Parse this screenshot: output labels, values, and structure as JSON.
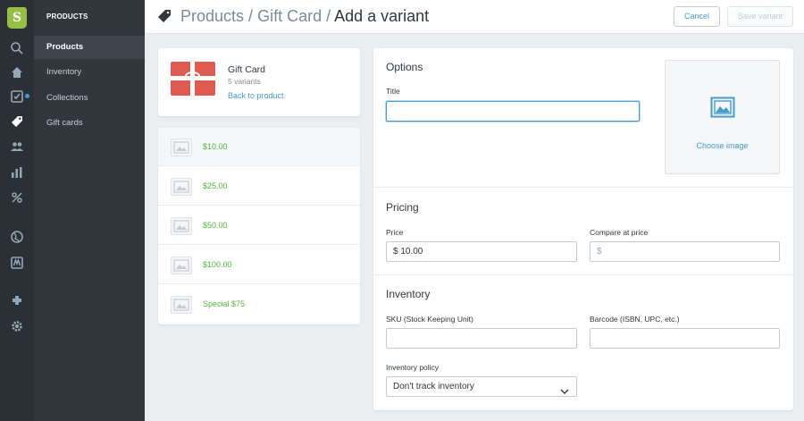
{
  "nav": {
    "header": "PRODUCTS",
    "items": [
      {
        "label": "Products",
        "active": true
      },
      {
        "label": "Inventory",
        "active": false
      },
      {
        "label": "Collections",
        "active": false
      },
      {
        "label": "Gift cards",
        "active": false
      }
    ]
  },
  "rail_icons": [
    "search-icon",
    "home-icon",
    "orders-icon",
    "tag-icon",
    "customers-icon",
    "reports-icon",
    "discounts-icon",
    "globe-icon",
    "apps-icon",
    "plugin-icon",
    "settings-icon"
  ],
  "header": {
    "breadcrumb": [
      "Products",
      "Gift Card"
    ],
    "separator": " / ",
    "current": "Add a variant",
    "cancel_label": "Cancel",
    "save_label": "Save variant"
  },
  "product": {
    "name": "Gift Card",
    "variant_count": "5 variants",
    "back_link": "Back to product"
  },
  "variants": [
    {
      "label": "$10.00"
    },
    {
      "label": "$25.00"
    },
    {
      "label": "$50.00"
    },
    {
      "label": "$100.00"
    },
    {
      "label": "Special $75"
    }
  ],
  "options": {
    "title": "Options",
    "title_label": "Title",
    "title_value": "",
    "choose_image": "Choose image"
  },
  "pricing": {
    "title": "Pricing",
    "price_label": "Price",
    "price_value": "$ 10.00",
    "compare_label": "Compare at price",
    "compare_placeholder": "$"
  },
  "inventory": {
    "title": "Inventory",
    "sku_label": "SKU (Stock Keeping Unit)",
    "barcode_label": "Barcode (ISBN, UPC, etc.)",
    "policy_label": "Inventory policy",
    "policy_value": "Don't track inventory"
  },
  "colors": {
    "accent": "#479ccf",
    "variant_price": "#50b83c",
    "brand": "#95bf47"
  }
}
